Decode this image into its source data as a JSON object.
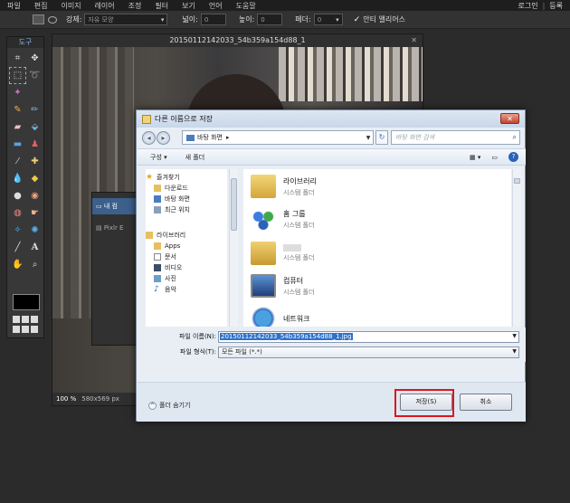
{
  "menubar": {
    "items": [
      "파일",
      "편집",
      "이미지",
      "레이어",
      "조정",
      "필터",
      "보기",
      "언어",
      "도움말"
    ],
    "login": "로그인",
    "separator": "|",
    "register": "등록"
  },
  "optbar": {
    "shape_value": "",
    "mode_label": "강제:",
    "mode_value": "자유 모양",
    "width_label": "넓이:",
    "width_value": "0",
    "height_label": "높이:",
    "height_value": "0",
    "feather_label": "페더:",
    "feather_value": "0",
    "antialias_label": "안티 앨리어스",
    "antialias_checked": true
  },
  "tools": {
    "title": "도구"
  },
  "image_window": {
    "title": "20150112142033_54b359a154d88_1",
    "controls": "✕",
    "zoom": "100",
    "zoom_unit": "%",
    "size": "580x569 px"
  },
  "behind_window": {
    "selected_item": "내 컴",
    "item2": "Pixlr E"
  },
  "dialog": {
    "title": "다른 이름으로 저장",
    "close": "✕",
    "address": "바탕 화면",
    "address_arrow": "▸",
    "search_placeholder": "바탕 화면 검색",
    "cmd_organize": "구성 ▾",
    "cmd_newfolder": "새 폴더",
    "help": "?",
    "nav": {
      "favorites": "즐겨찾기",
      "downloads": "다운로드",
      "desktop": "바탕 화면",
      "recent": "최근 위치",
      "libraries": "라이브러리",
      "apps": "Apps",
      "documents": "문서",
      "videos": "비디오",
      "pictures": "사진",
      "music": "음악"
    },
    "files": [
      {
        "name": "라이브러리",
        "type": "시스템 폴더"
      },
      {
        "name": "홈 그룹",
        "type": "시스템 폴더"
      },
      {
        "name": "",
        "type": "시스템 폴더"
      },
      {
        "name": "컴퓨터",
        "type": "시스템 폴더"
      },
      {
        "name": "네트워크",
        "type": ""
      }
    ],
    "filename_label": "파일 이름(N):",
    "filename_value": "20150112142033_54b359a154d88_1.jpg",
    "filetype_label": "파일 형식(T):",
    "filetype_value": "모든 파일 (*.*)",
    "hide_folders": "폴더 숨기기",
    "save": "저장(S)",
    "cancel": "취소"
  }
}
